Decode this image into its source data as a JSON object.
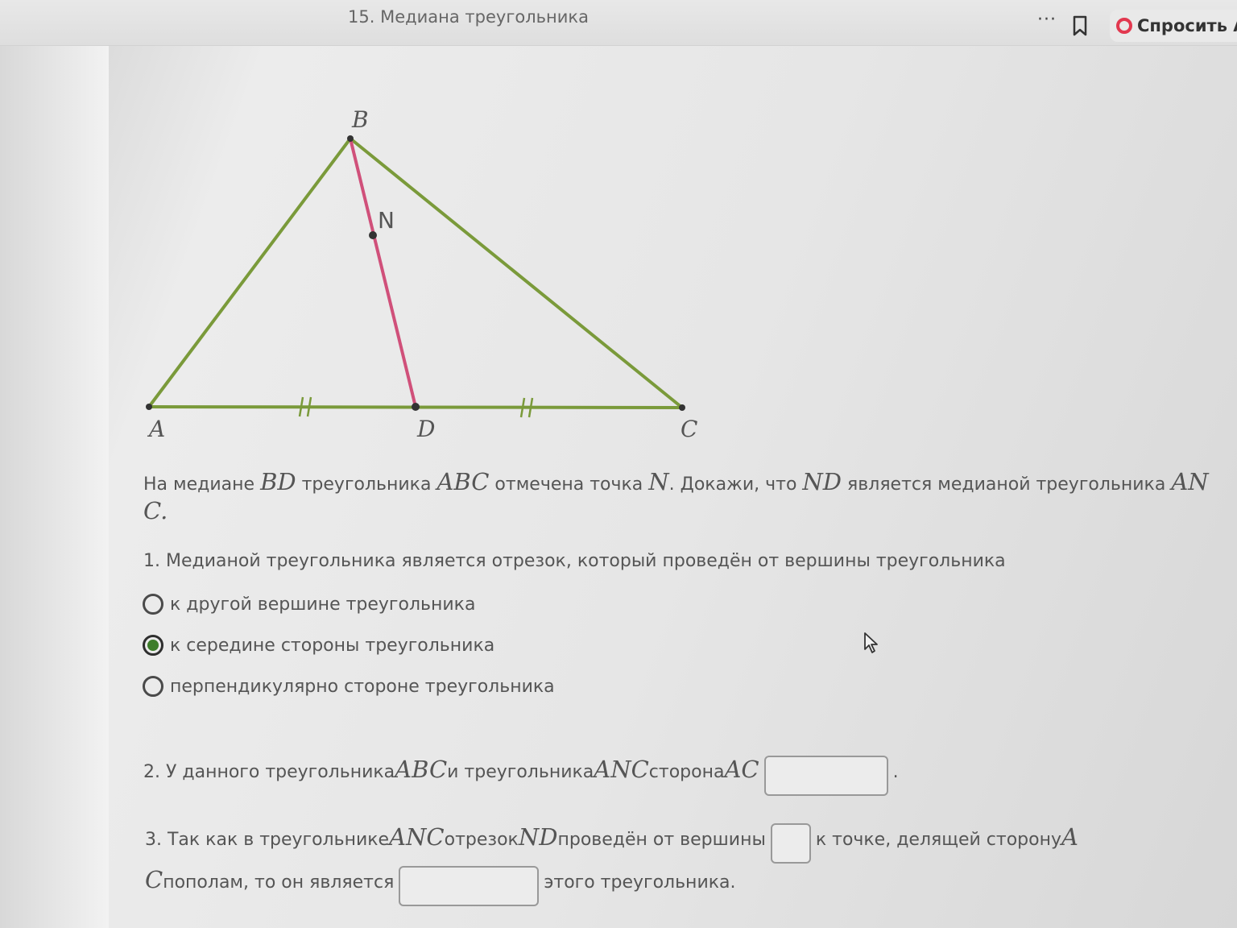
{
  "header": {
    "lesson_title": "15. Медиана треугольника",
    "more_label": "···",
    "ask_label": "Спросить А"
  },
  "figure": {
    "labels": {
      "A": "A",
      "B": "B",
      "C": "C",
      "D": "D",
      "N": "N"
    },
    "colors": {
      "triangle": "#7a9a3a",
      "median": "#d0507a",
      "points": "#333333"
    }
  },
  "problem": {
    "p1": "На медиане ",
    "m1": "BD",
    "p2": " треугольника ",
    "m2": "ABC",
    "p3": " отмечена точка ",
    "m3": "N",
    "p4": ". Докажи, что ",
    "m4": "ND",
    "p5": " является медианой треугольника ",
    "m5": "AN",
    "m6": "C",
    "p6": "."
  },
  "question1": {
    "text": "1. Медианой треугольника является отрезок, который проведён от вершины треугольника",
    "options": [
      {
        "label": "к другой вершине треугольника",
        "selected": false
      },
      {
        "label": "к середине стороны треугольника",
        "selected": true
      },
      {
        "label": "перпендикулярно стороне треугольника",
        "selected": false
      }
    ]
  },
  "question2": {
    "p1": "2. У данного треугольника ",
    "m1": "ABC",
    "p2": " и треугольника ",
    "m2": "ANC",
    "p3": " сторона ",
    "m3": "AC",
    "answer": "",
    "end": "."
  },
  "question3": {
    "p1": "3. Так как в треугольнике ",
    "m1": "ANC",
    "p2": " отрезок ",
    "m2": "ND",
    "p3": " проведён от вершины",
    "answer1": "",
    "p4": "к точке, делящей сторону ",
    "m3": "A",
    "m4": "C",
    "p5": " пополам, то он является",
    "answer2": "",
    "p6": "этого треугольника."
  }
}
